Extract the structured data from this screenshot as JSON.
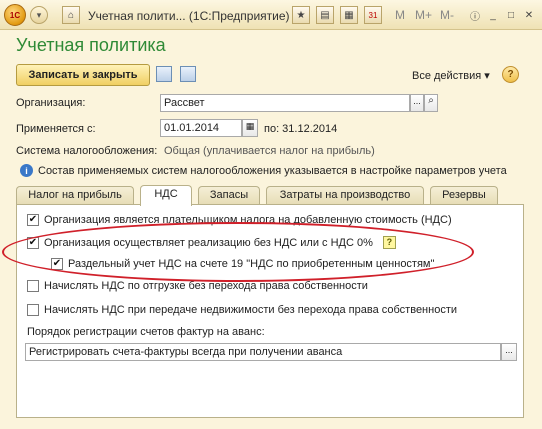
{
  "window": {
    "title": "Учетная полити... (1С:Предприятие)",
    "m_buttons": [
      "M",
      "M+",
      "M-"
    ],
    "calendar_day": "31"
  },
  "page": {
    "title": "Учетная политика"
  },
  "toolbar": {
    "save_close_label": "Записать и закрыть",
    "all_actions_label": "Все действия ▾",
    "help_label": "?"
  },
  "form": {
    "org_label": "Организация:",
    "org_value": "Рассвет",
    "applies_label": "Применяется с:",
    "applies_date": "01.01.2014",
    "applies_to": "по: 31.12.2014",
    "tax_system_label": "Система налогообложения:",
    "tax_system_value": "Общая (уплачивается налог на прибыль)",
    "info_text": "Состав применяемых систем налогообложения указывается в настройке параметров учета"
  },
  "tabs": [
    {
      "label": "Налог на прибыль"
    },
    {
      "label": "НДС"
    },
    {
      "label": "Запасы"
    },
    {
      "label": "Затраты на производство"
    },
    {
      "label": "Резервы"
    }
  ],
  "vat": {
    "cb1": "Организация является плательщиком налога на добавленную стоимость (НДС)",
    "cb2": "Организация осуществляет реализацию без НДС или с НДС 0%",
    "cb2_help": "?",
    "cb3": "Раздельный учет НДС на счете 19 \"НДС по приобретенным ценностям\"",
    "cb4": "Начислять НДС по отгрузке без перехода права собственности",
    "cb5": "Начислять НДС при передаче недвижимости без перехода права собственности",
    "invoice_label": "Порядок регистрации счетов фактур на аванс:",
    "invoice_value": "Регистрировать счета-фактуры всегда при получении аванса"
  },
  "checks": {
    "cb1": true,
    "cb2": true,
    "cb3": true,
    "cb4": false,
    "cb5": false
  },
  "colors": {
    "title_green": "#2f8a36",
    "highlight_red": "#d0202a",
    "save_yellow": "#f0cf63"
  }
}
